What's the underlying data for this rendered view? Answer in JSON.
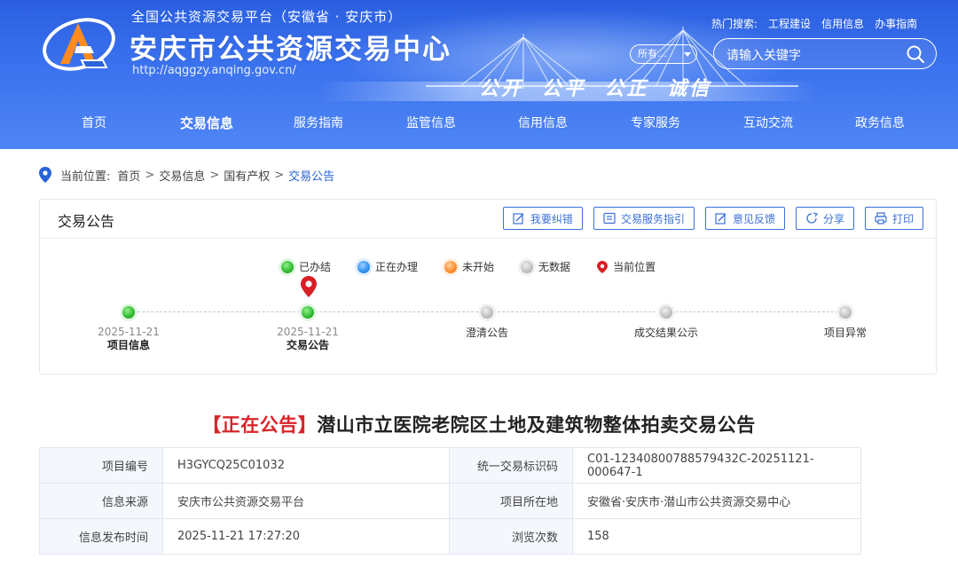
{
  "header": {
    "sub_title": "全国公共资源交易平台（安徽省 · 安庆市）",
    "title": "安庆市公共资源交易中心",
    "url": "http://aqggzy.anqing.gov.cn/",
    "hot_label": "热门搜索:",
    "hot_links": [
      "工程建设",
      "信用信息",
      "办事指南"
    ],
    "scope_value": "所有…",
    "search_placeholder": "请输入关键字",
    "motto": "公开 公平 公正 诚信"
  },
  "nav": [
    "首页",
    "交易信息",
    "服务指南",
    "监管信息",
    "信用信息",
    "专家服务",
    "互动交流",
    "政务信息"
  ],
  "nav_active": "交易信息",
  "breadcrumb": {
    "label": "当前位置:",
    "items": [
      "首页",
      "交易信息",
      "国有产权",
      "交易公告"
    ]
  },
  "panel": {
    "title": "交易公告",
    "actions": [
      "我要纠错",
      "交易服务指引",
      "意见反馈",
      "分享",
      "打印"
    ],
    "legend": [
      "已办结",
      "正在办理",
      "未开始",
      "无数据",
      "当前位置"
    ],
    "steps": [
      {
        "date": "2025-11-21",
        "name": "项目信息",
        "status": "done"
      },
      {
        "date": "2025-11-21",
        "name": "交易公告",
        "status": "done"
      },
      {
        "date": "",
        "name": "澄清公告",
        "status": "none"
      },
      {
        "date": "",
        "name": "成交结果公示",
        "status": "none"
      },
      {
        "date": "",
        "name": "项目异常",
        "status": "none"
      }
    ]
  },
  "article": {
    "tag": "【正在公告】",
    "title": "潜山市立医院老院区土地及建筑物整体拍卖交易公告",
    "rows": [
      [
        "项目编号",
        "H3GYCQ25C01032",
        "统一交易标识码",
        "C01-12340800788579432C-20251121-000647-1"
      ],
      [
        "信息来源",
        "安庆市公共资源交易平台",
        "项目所在地",
        "安徽省·安庆市·潜山市公共资源交易中心"
      ],
      [
        "信息发布时间",
        "2025-11-21 17:27:20",
        "浏览次数",
        "158"
      ]
    ]
  },
  "colors": {
    "header_blue": "#3b72ee",
    "accent_blue": "#3b6fd8",
    "tag_red": "#d8252a",
    "marker_red": "#d71f26"
  }
}
